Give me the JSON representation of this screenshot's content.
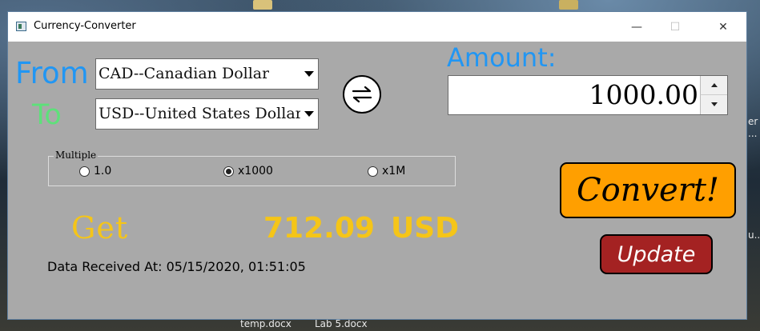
{
  "window": {
    "title": "Currency-Converter",
    "controls": {
      "minimize": "—",
      "maximize": "☐",
      "close": "✕"
    }
  },
  "desktop": {
    "files": [
      "temp.docx",
      "Lab 5.docx"
    ],
    "partial_text": [
      "er",
      "...",
      "u..."
    ]
  },
  "from": {
    "label": "From",
    "selected": "CAD--Canadian Dollar"
  },
  "to": {
    "label": "To",
    "selected": "USD--United States Dollar"
  },
  "swap": {
    "icon": "swap-arrows-icon"
  },
  "amount": {
    "label": "Amount:",
    "value": "1000.00"
  },
  "multiple": {
    "title": "Multiple",
    "options": [
      {
        "label": "1.0",
        "checked": false
      },
      {
        "label": "x1000",
        "checked": true
      },
      {
        "label": "x1M",
        "checked": false
      }
    ]
  },
  "result": {
    "label": "Get",
    "value": "712.09",
    "currency": "USD"
  },
  "received": "Data Received At: 05/15/2020, 01:51:05",
  "buttons": {
    "convert": "Convert!",
    "update": "Update"
  },
  "colors": {
    "from_label": "#2196f3",
    "to_label": "#5ee07a",
    "amount_label": "#2196f3",
    "result": "#f5c518",
    "convert_bg": "#ff9f00",
    "update_bg": "#a42222",
    "window_bg": "#a9a9a9"
  }
}
